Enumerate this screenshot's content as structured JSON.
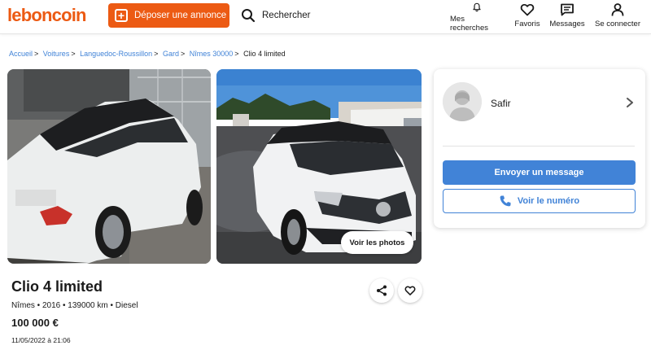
{
  "header": {
    "logo": "leboncoin",
    "post_button": "Déposer une annonce",
    "search_label": "Rechercher",
    "nav": [
      {
        "label": "Mes recherches",
        "icon": "bell-icon"
      },
      {
        "label": "Favoris",
        "icon": "heart-icon"
      },
      {
        "label": "Messages",
        "icon": "message-icon"
      },
      {
        "label": "Se connecter",
        "icon": "user-icon"
      }
    ],
    "accent_color": "#ec5a13"
  },
  "breadcrumb": {
    "items": [
      "Accueil",
      "Voitures",
      "Languedoc-Roussillon",
      "Gard",
      "Nîmes 30000"
    ],
    "current": "Clio 4 limited",
    "link_color": "#4183d7"
  },
  "gallery": {
    "see_photos_button": "Voir les photos"
  },
  "listing": {
    "title": "Clio 4 limited",
    "specs": "Nîmes • 2016 • 139000 km • Diesel",
    "price": "100 000 €",
    "date": "11/05/2022 à 21:06"
  },
  "seller": {
    "name": "Safir",
    "message_button": "Envoyer un message",
    "phone_button": "Voir le numéro",
    "button_color": "#4183d7"
  }
}
